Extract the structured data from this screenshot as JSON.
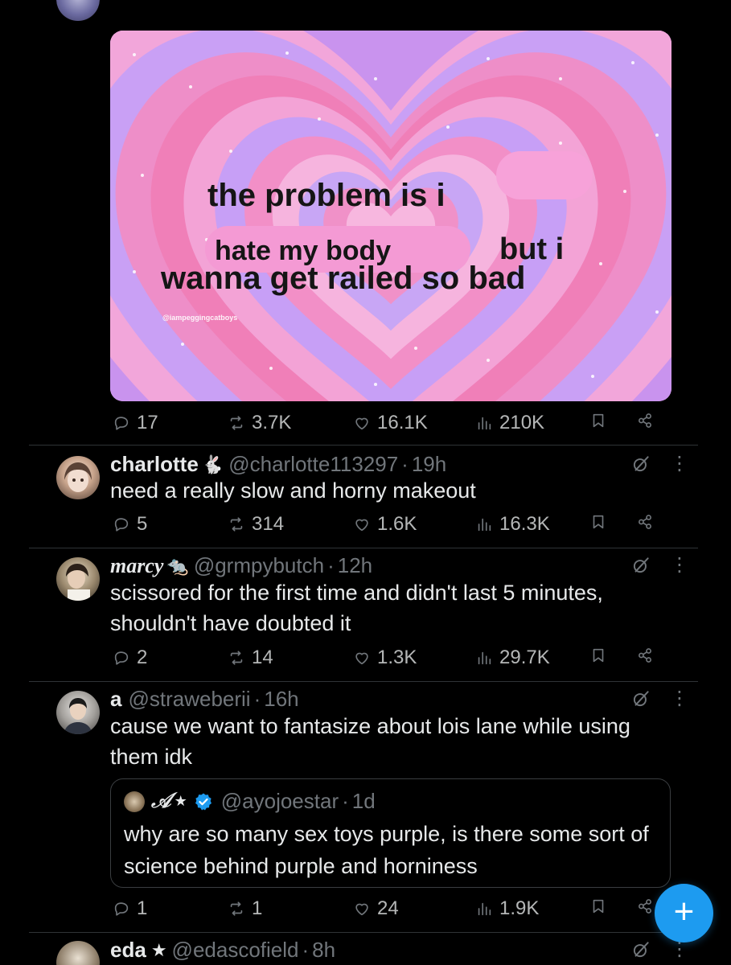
{
  "media": {
    "caption_line1": "the problem is i",
    "caption_line2a": "hate my body",
    "caption_line2b": "but i",
    "caption_line3": "wanna get railed so bad",
    "watermark": "@iampeggingcatboys"
  },
  "top_tweet": {
    "actions": {
      "replies": "17",
      "reposts": "3.7K",
      "likes": "16.1K",
      "views": "210K"
    }
  },
  "replies": [
    {
      "name": "charlotte",
      "emoji": "🐇",
      "handle": "@charlotte113297",
      "dot": "·",
      "time": "19h",
      "text": "need a really slow and horny makeout",
      "actions": {
        "replies": "5",
        "reposts": "314",
        "likes": "1.6K",
        "views": "16.3K"
      }
    },
    {
      "name": "marcy",
      "emoji": "🐀",
      "handle": "@grmpybutch",
      "dot": "·",
      "time": "12h",
      "text": "scissored for the first time and didn't last 5 minutes, shouldn't have doubted it",
      "actions": {
        "replies": "2",
        "reposts": "14",
        "likes": "1.3K",
        "views": "29.7K"
      }
    },
    {
      "name": "a",
      "handle": "@straweberii",
      "dot": "·",
      "time": "16h",
      "text": "cause we want to fantasize about lois lane while using them idk",
      "quote": {
        "name": "𝒜",
        "star": "★",
        "handle": "@ayojoestar",
        "dot": "·",
        "time": "1d",
        "text": "why are so many sex toys purple, is there some sort of science behind purple and horniness"
      },
      "actions": {
        "replies": "1",
        "reposts": "1",
        "likes": "24",
        "views": "1.9K"
      }
    },
    {
      "name": "eda",
      "star": "★",
      "handle": "@edascofield",
      "dot": "·",
      "time": "8h"
    }
  ],
  "fab": {
    "label": "+"
  },
  "colors": {
    "accent": "#1d9bf0",
    "muted": "#71767b",
    "text": "#e7e9ea",
    "background": "#000000"
  }
}
